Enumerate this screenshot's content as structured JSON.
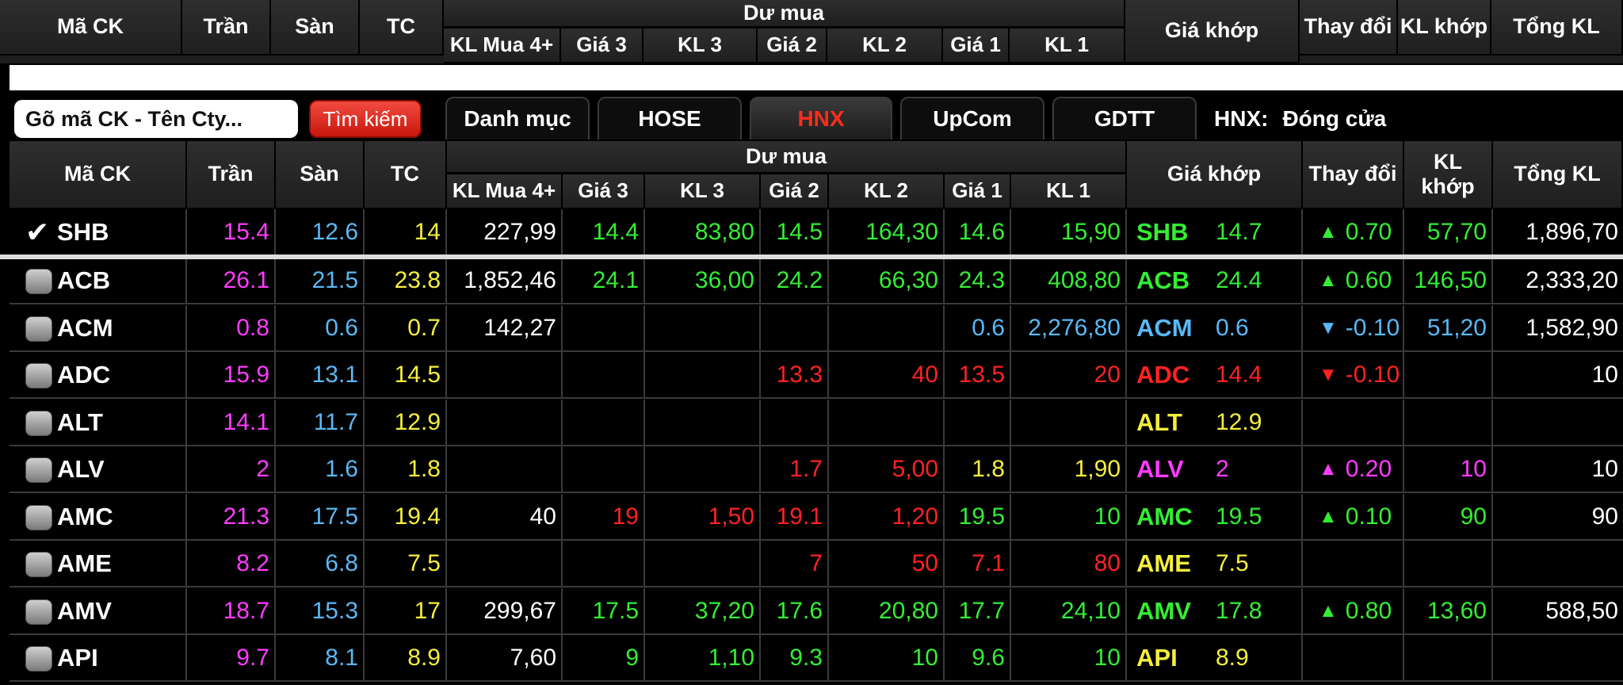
{
  "header": {
    "ma_ck": "Mã CK",
    "tran": "Trần",
    "san": "Sàn",
    "tc": "TC",
    "du_mua": "Dư mua",
    "kl_mua4": "KL Mua 4+",
    "gia3": "Giá 3",
    "kl3": "KL 3",
    "gia2": "Giá 2",
    "kl2": "KL 2",
    "gia1": "Giá 1",
    "kl1": "KL 1",
    "gia_khop": "Giá khớp",
    "thay_doi": "Thay đổi",
    "kl_khop": "KL khớp",
    "tong_kl": "Tổng KL"
  },
  "toolbar": {
    "search_placeholder": "Gõ mã CK - Tên Cty...",
    "search_button": "Tìm kiếm",
    "tabs": [
      "Danh mục",
      "HOSE",
      "HNX",
      "UpCom",
      "GDTT"
    ],
    "active_tab": "HNX",
    "market_name": "HNX:",
    "market_status": "Đóng cửa"
  },
  "colors": {
    "ceiling": "#ff3cff",
    "floor": "#5ab8f5",
    "reference": "#f5ef3c",
    "up": "#33ee33",
    "down": "#ff2222",
    "white": "#ffffff",
    "accent_tab": "#ff2c1a"
  },
  "rows": [
    {
      "sym": "SHB",
      "checked": true,
      "tran": "15.4",
      "san": "12.6",
      "tc": "14",
      "kl4": "227,99",
      "g3": "14.4",
      "k3": "83,80",
      "g2": "14.5",
      "k2": "164,30",
      "g1": "14.6",
      "k1": "15,90",
      "price": "14.7",
      "chg": "0.70",
      "dir": "up",
      "klk": "57,70",
      "tkl": "1,896,70"
    },
    {
      "sym": "ACB",
      "checked": false,
      "tran": "26.1",
      "san": "21.5",
      "tc": "23.8",
      "kl4": "1,852,46",
      "g3": "24.1",
      "k3": "36,00",
      "g2": "24.2",
      "k2": "66,30",
      "g1": "24.3",
      "k1": "408,80",
      "price": "24.4",
      "chg": "0.60",
      "dir": "up",
      "klk": "146,50",
      "tkl": "2,333,20"
    },
    {
      "sym": "ACM",
      "checked": false,
      "tran": "0.8",
      "san": "0.6",
      "tc": "0.7",
      "kl4": "142,27",
      "g3": "",
      "k3": "",
      "g2": "",
      "k2": "",
      "g1": "0.6",
      "k1": "2,276,80",
      "price": "0.6",
      "chg": "-0.10",
      "dir": "floor",
      "klk": "51,20",
      "tkl": "1,582,90"
    },
    {
      "sym": "ADC",
      "checked": false,
      "tran": "15.9",
      "san": "13.1",
      "tc": "14.5",
      "kl4": "",
      "g3": "",
      "k3": "",
      "g2": "13.3",
      "k2": "40",
      "g1": "13.5",
      "k1": "20",
      "price": "14.4",
      "chg": "-0.10",
      "dir": "down",
      "klk": "",
      "tkl": "10"
    },
    {
      "sym": "ALT",
      "checked": false,
      "tran": "14.1",
      "san": "11.7",
      "tc": "12.9",
      "kl4": "",
      "g3": "",
      "k3": "",
      "g2": "",
      "k2": "",
      "g1": "",
      "k1": "",
      "price": "12.9",
      "chg": "",
      "dir": "ref",
      "klk": "",
      "tkl": ""
    },
    {
      "sym": "ALV",
      "checked": false,
      "tran": "2",
      "san": "1.6",
      "tc": "1.8",
      "kl4": "",
      "g3": "",
      "k3": "",
      "g2": "1.7",
      "k2": "5,00",
      "g1": "1.8",
      "k1": "1,90",
      "price": "2",
      "chg": "0.20",
      "dir": "ceil",
      "klk": "10",
      "tkl": "10"
    },
    {
      "sym": "AMC",
      "checked": false,
      "tran": "21.3",
      "san": "17.5",
      "tc": "19.4",
      "kl4": "40",
      "g3": "19",
      "k3": "1,50",
      "g2": "19.1",
      "k2": "1,20",
      "g1": "19.5",
      "k1": "10",
      "price": "19.5",
      "chg": "0.10",
      "dir": "up",
      "klk": "90",
      "tkl": "90"
    },
    {
      "sym": "AME",
      "checked": false,
      "tran": "8.2",
      "san": "6.8",
      "tc": "7.5",
      "kl4": "",
      "g3": "",
      "k3": "",
      "g2": "7",
      "k2": "50",
      "g1": "7.1",
      "k1": "80",
      "price": "7.5",
      "chg": "",
      "dir": "ref",
      "klk": "",
      "tkl": ""
    },
    {
      "sym": "AMV",
      "checked": false,
      "tran": "18.7",
      "san": "15.3",
      "tc": "17",
      "kl4": "299,67",
      "g3": "17.5",
      "k3": "37,20",
      "g2": "17.6",
      "k2": "20,80",
      "g1": "17.7",
      "k1": "24,10",
      "price": "17.8",
      "chg": "0.80",
      "dir": "up",
      "klk": "13,60",
      "tkl": "588,50"
    },
    {
      "sym": "API",
      "checked": false,
      "tran": "9.7",
      "san": "8.1",
      "tc": "8.9",
      "kl4": "7,60",
      "g3": "9",
      "k3": "1,10",
      "g2": "9.3",
      "k2": "10",
      "g1": "9.6",
      "k1": "10",
      "price": "8.9",
      "chg": "",
      "dir": "ref",
      "klk": "",
      "tkl": ""
    }
  ],
  "bid_colors": {
    "SHB": {
      "g3": "up",
      "k3": "up",
      "g2": "up",
      "k2": "up",
      "g1": "up",
      "k1": "up"
    },
    "ACB": {
      "g3": "up",
      "k3": "up",
      "g2": "up",
      "k2": "up",
      "g1": "up",
      "k1": "up"
    },
    "ACM": {
      "g1": "floor",
      "k1": "floor"
    },
    "ADC": {
      "g2": "down",
      "k2": "down",
      "g1": "down",
      "k1": "down"
    },
    "ALV": {
      "g2": "down",
      "k2": "down",
      "g1": "ref",
      "k1": "ref"
    },
    "AMC": {
      "g3": "down",
      "k3": "down",
      "g2": "down",
      "k2": "down",
      "g1": "up",
      "k1": "up"
    },
    "AME": {
      "g2": "down",
      "k2": "down",
      "g1": "down",
      "k1": "down"
    },
    "AMV": {
      "g3": "up",
      "k3": "up",
      "g2": "up",
      "k2": "up",
      "g1": "up",
      "k1": "up"
    },
    "API": {
      "g3": "up",
      "k3": "up",
      "g2": "up",
      "k2": "up",
      "g1": "up",
      "k1": "up"
    }
  }
}
